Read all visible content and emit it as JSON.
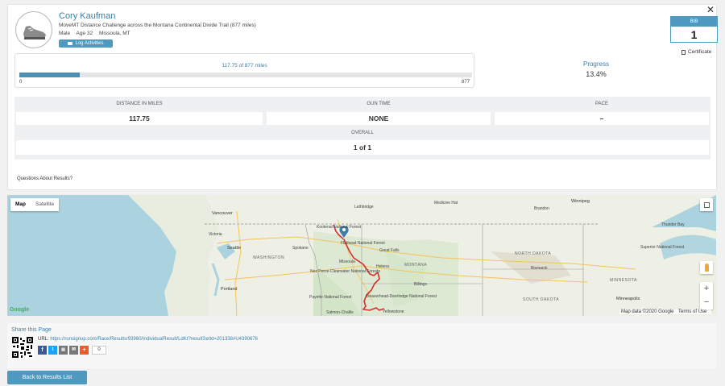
{
  "participant": {
    "name": "Cory Kaufman",
    "event": "MoveMT Distance Challenge across the Montana Continental Divide Trail (877 miles)",
    "gender": "Male",
    "age": "Age 32",
    "location": "Missoula, MT",
    "log_button": "Log Activities",
    "avatar_icon": "shoe-icon"
  },
  "bib": {
    "label": "BIB",
    "number": "1",
    "certificate": "Certificate"
  },
  "progress": {
    "label": "117.75 of 877 miles",
    "min": "0",
    "max": "877",
    "fraction": 0.134,
    "title": "Progress",
    "percent": "13.4%"
  },
  "stats": {
    "distance_header": "DISTANCE IN MILES",
    "distance_value": "117.75",
    "gun_header": "GUN TIME",
    "gun_value": "NONE",
    "pace_header": "PACE",
    "pace_value": "–",
    "overall_header": "OVERALL",
    "overall_value": "1 of 1"
  },
  "questions": "Questions About Results?",
  "map": {
    "tab_map": "Map",
    "tab_satellite": "Satellite",
    "zoom_in": "+",
    "zoom_out": "−",
    "google": "Google",
    "attribution_data": "Map data ©2020 Google",
    "attribution_terms": "Terms of Use",
    "labels": {
      "vancouver": "Vancouver",
      "victoria": "Victoria",
      "seattle": "Seattle",
      "washington": "WASHINGTON",
      "spokane": "Spokane",
      "portland": "Portland",
      "montana": "MONTANA",
      "great_falls": "Great Falls",
      "helena": "Helena",
      "missoula": "Missoula",
      "billings": "Billings",
      "yellowstone": "Yellowstone",
      "kootenai": "Kootenai National Forest",
      "flathead": "Flathead National Forest",
      "lethbridge": "Lethbridge",
      "winnipeg": "Winnipeg",
      "north_dakota": "NORTH DAKOTA",
      "south_dakota": "SOUTH DAKOTA",
      "minnesota": "MINNESOTA",
      "minneapolis": "Minneapolis",
      "bismarck": "Bismarck",
      "nez_perce": "Nez Perce-Clearwater National Forests",
      "payette": "Payette National Forest",
      "beaverhead": "Beaverhead-Deerlodge National Forest",
      "salmon": "Salmon-Challis",
      "superior": "Superior National Forest",
      "medicine_hat": "Medicine Hat",
      "brandon": "Brandon",
      "thunder_bay": "Thunder Bay"
    }
  },
  "share": {
    "title": "Share this Page",
    "url_label": "URL:",
    "url": "https://runsignup.com/Race/Results/93960/IndividualResult/LdKt?resultSetId=201338#U4390676",
    "count": "0"
  },
  "back_button": "Back to Results List",
  "colors": {
    "accent": "#4d99bf",
    "route": "#d43030"
  }
}
